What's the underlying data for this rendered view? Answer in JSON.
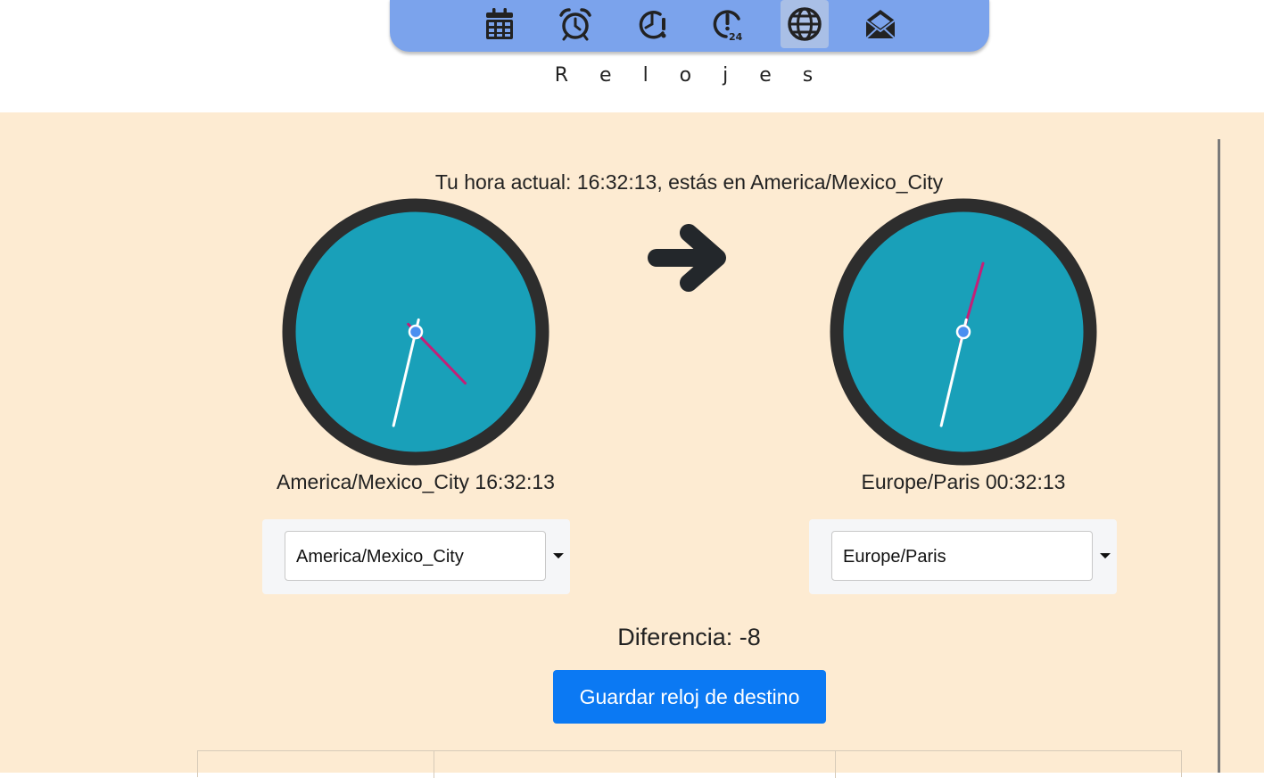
{
  "nav": {
    "items": [
      {
        "icon": "calendar-icon",
        "active": false
      },
      {
        "icon": "alarm-clock-icon",
        "active": false
      },
      {
        "icon": "timer-alert-icon",
        "active": false
      },
      {
        "icon": "clock-24-alert-icon",
        "active": false
      },
      {
        "icon": "globe-icon",
        "active": true
      },
      {
        "icon": "envelope-open-icon",
        "active": false
      }
    ]
  },
  "page": {
    "subtitle": "R e l o j e s",
    "current_time_text": "Tu hora actual: 16:32:13, estás en America/Mexico_City"
  },
  "clocks": {
    "origin": {
      "label": "America/Mexico_City 16:32:13",
      "time": {
        "hours": 16,
        "minutes": 32,
        "seconds": 13
      },
      "selected_zone": "America/Mexico_City"
    },
    "destination": {
      "label": "Europe/Paris 00:32:13",
      "time": {
        "hours": 0,
        "minutes": 32,
        "seconds": 13
      },
      "selected_zone": "Europe/Paris"
    }
  },
  "difference_text": "Diferencia: -8",
  "save_button_label": "Guardar reloj de destino",
  "colors": {
    "nav_bg": "#7ba3ec",
    "content_bg": "#fdebd2",
    "clock_face": "#19a0b9",
    "clock_rim": "#2d2d2d",
    "hand_primary": "#ffffff",
    "hand_secondary": "#c41f78",
    "center_dot": "#4a8ff0",
    "button_bg": "#0b79f3"
  }
}
